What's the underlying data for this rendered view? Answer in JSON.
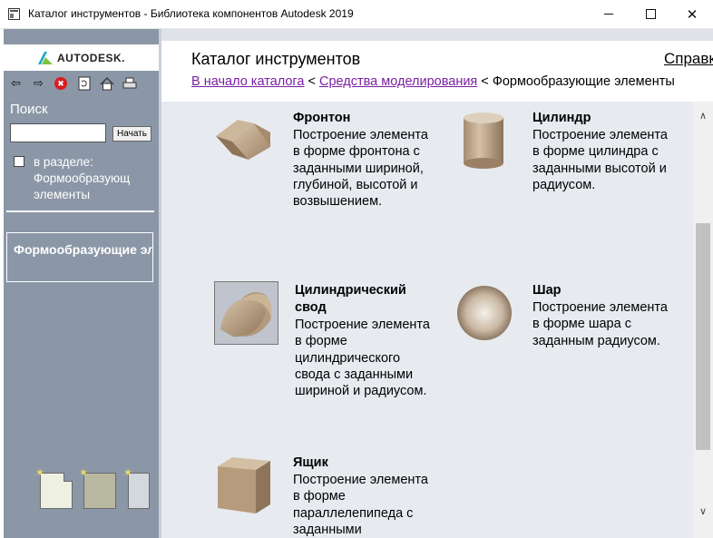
{
  "window": {
    "title": "Каталог инструментов - Библиотека компонентов Autodesk 2019",
    "minimize_glyph": "—",
    "maximize_glyph": "☐",
    "close_glyph": "✕"
  },
  "sidebar": {
    "logo_text": "AUTODESK.",
    "toolbar_icons": [
      "back-arrow-icon",
      "forward-arrow-icon",
      "stop-icon",
      "refresh-icon",
      "home-icon",
      "print-icon"
    ],
    "search_label": "Поиск",
    "search_value": "",
    "search_button": "Начать",
    "in_section_label": "в разделе: Формообразующ элементы",
    "in_section_checked": false,
    "nav_item": "Формообразующие элементы",
    "colors": {
      "pane": "#8b97a7",
      "logo_accent": "#1fa9c9"
    }
  },
  "header": {
    "title": "Каталог инструментов",
    "help_link": "Справка",
    "breadcrumb": {
      "link1": "В начало каталога",
      "sep": " < ",
      "link2": "Средства моделирования",
      "current": "Формообразующие элементы"
    },
    "link_color": "#7b1fa2"
  },
  "items": [
    {
      "title": "Фронтон",
      "desc": "Построение элемента в форме фронтона с заданными шириной, глубиной, высотой и возвышением.",
      "icon": "gable-shape-icon"
    },
    {
      "title": "Цилиндр",
      "desc": "Построение элемента в форме цилиндра с заданными высотой и радиусом.",
      "icon": "cylinder-shape-icon"
    },
    {
      "title": "Цилиндрический свод",
      "desc": "Построение элемента в форме цилиндрического свода с заданными шириной и радиусом.",
      "icon": "barrel-vault-icon"
    },
    {
      "title": "Шар",
      "desc": "Построение элемента в форме шара с заданным радиусом.",
      "icon": "sphere-shape-icon"
    },
    {
      "title": "Ящик",
      "desc": "Построение элемента в форме параллелепипеда с заданными",
      "icon": "box-shape-icon"
    }
  ]
}
